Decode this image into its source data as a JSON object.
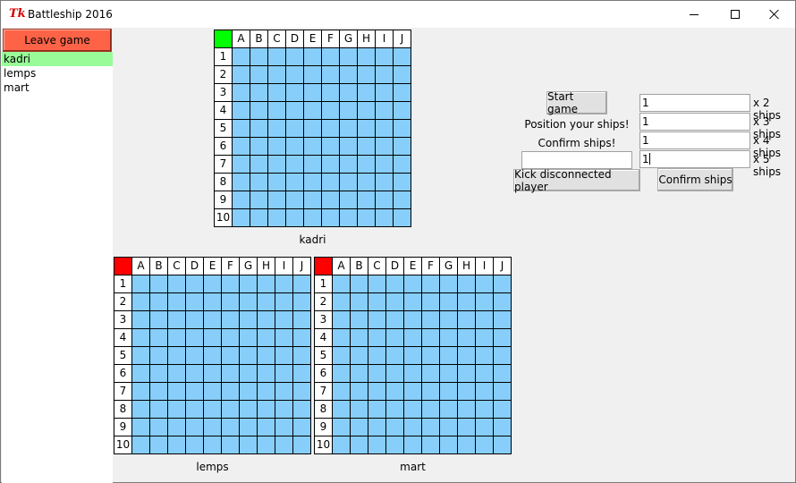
{
  "window": {
    "title": "Battleship 2016",
    "app_icon": "Tk"
  },
  "sidebar": {
    "leave_button": "Leave game",
    "players": [
      {
        "name": "kadri",
        "selected": true
      },
      {
        "name": "lemps",
        "selected": false
      },
      {
        "name": "mart",
        "selected": false
      }
    ]
  },
  "board_columns": [
    "A",
    "B",
    "C",
    "D",
    "E",
    "F",
    "G",
    "H",
    "I",
    "J"
  ],
  "board_rows": [
    "1",
    "2",
    "3",
    "4",
    "5",
    "6",
    "7",
    "8",
    "9",
    "10"
  ],
  "boards": [
    {
      "player": "kadri",
      "corner_color": "#00ff00"
    },
    {
      "player": "lemps",
      "corner_color": "#ff0000"
    },
    {
      "player": "mart",
      "corner_color": "#ff0000"
    }
  ],
  "controls": {
    "start_game": "Start game",
    "status_position": "Position your ships!",
    "status_confirm": "Confirm ships!",
    "kick_input_value": "",
    "kick_button": "Kick disconnected player",
    "confirm_button": "Confirm ships",
    "ships": [
      {
        "count": "1",
        "label": "x 2 ships"
      },
      {
        "count": "1",
        "label": "x 3 ships"
      },
      {
        "count": "1",
        "label": "x 4 ships"
      },
      {
        "count": "1",
        "label": "x 5 ships"
      }
    ]
  },
  "colors": {
    "water": "#87cefa",
    "leave_button": "#ff6347",
    "selected_player": "#98fb98"
  }
}
